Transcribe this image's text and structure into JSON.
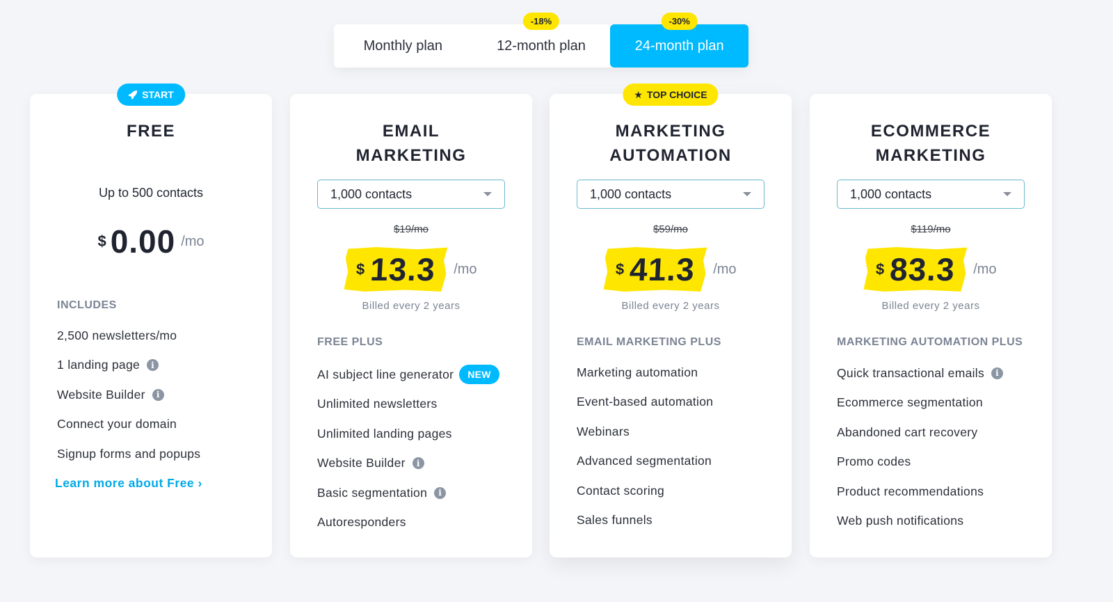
{
  "plan_toggle": {
    "options": [
      {
        "label": "Monthly plan",
        "discount": ""
      },
      {
        "label": "12-month plan",
        "discount": "-18%"
      },
      {
        "label": "24-month plan",
        "discount": "-30%"
      }
    ],
    "selected": "24-month plan"
  },
  "colors": {
    "accent": "#00baff",
    "highlight": "#ffe600",
    "background": "#f4f5f8"
  },
  "cards": [
    {
      "badge": {
        "label": "START",
        "icon": "rocket-icon"
      },
      "title": "FREE",
      "contacts": "Up to 500 contacts",
      "currency": "$",
      "price": "0.00",
      "per": "/mo",
      "section": "INCLUDES",
      "features": [
        {
          "label": "2,500 newsletters/mo"
        },
        {
          "label": "1 landing page",
          "info": true
        },
        {
          "label": "Website Builder",
          "info": true
        },
        {
          "label": "Connect your domain"
        },
        {
          "label": "Signup forms and popups"
        }
      ],
      "link": "Learn more about Free ›"
    },
    {
      "title_lines": [
        "EMAIL",
        "MARKETING"
      ],
      "dropdown": "1,000 contacts",
      "old_price": "$19/mo",
      "currency": "$",
      "price": "13.3",
      "per": "/mo",
      "billed": "Billed every 2 years",
      "section": "FREE PLUS",
      "features": [
        {
          "label": "AI subject line generator",
          "badge": "NEW"
        },
        {
          "label": "Unlimited newsletters"
        },
        {
          "label": "Unlimited landing pages"
        },
        {
          "label": "Website Builder",
          "info": true
        },
        {
          "label": "Basic segmentation",
          "info": true
        },
        {
          "label": "Autoresponders"
        }
      ]
    },
    {
      "badge": {
        "label": "TOP CHOICE",
        "icon": "star-icon"
      },
      "title_lines": [
        "MARKETING",
        "AUTOMATION"
      ],
      "dropdown": "1,000 contacts",
      "old_price": "$59/mo",
      "currency": "$",
      "price": "41.3",
      "per": "/mo",
      "billed": "Billed every 2 years",
      "section": "EMAIL MARKETING PLUS",
      "features": [
        {
          "label": "Marketing automation"
        },
        {
          "label": "Event-based automation"
        },
        {
          "label": "Webinars"
        },
        {
          "label": "Advanced segmentation"
        },
        {
          "label": "Contact scoring"
        },
        {
          "label": "Sales funnels"
        }
      ]
    },
    {
      "title_lines": [
        "ECOMMERCE",
        "MARKETING"
      ],
      "dropdown": "1,000 contacts",
      "old_price": "$119/mo",
      "currency": "$",
      "price": "83.3",
      "per": "/mo",
      "billed": "Billed every 2 years",
      "section": "MARKETING AUTOMATION PLUS",
      "features": [
        {
          "label": "Quick transactional emails",
          "info": true
        },
        {
          "label": "Ecommerce segmentation"
        },
        {
          "label": "Abandoned cart recovery"
        },
        {
          "label": "Promo codes"
        },
        {
          "label": "Product recommendations"
        },
        {
          "label": "Web push notifications"
        }
      ]
    }
  ]
}
